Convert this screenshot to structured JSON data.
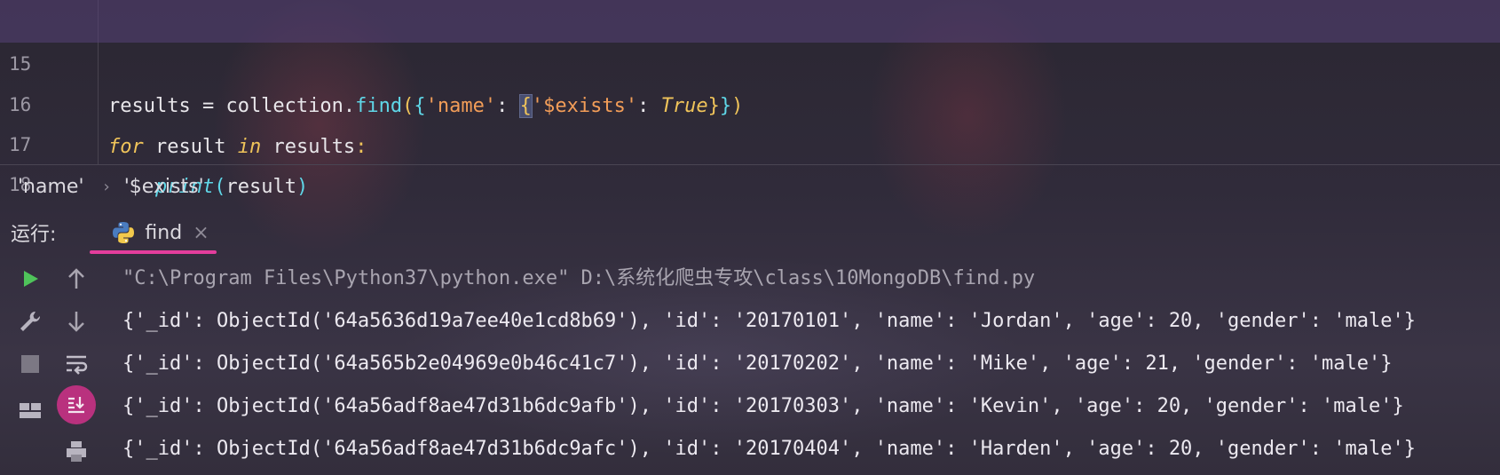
{
  "editor": {
    "lines": [
      {
        "number": "15",
        "text": "results = collection.find({'name': {'$exists': True}})"
      },
      {
        "number": "16",
        "text": "for result in results:"
      },
      {
        "number": "17",
        "text": "    print(result)"
      },
      {
        "number": "18",
        "text": ""
      }
    ]
  },
  "breadcrumb": {
    "items": [
      "'name'",
      "'$exists'"
    ],
    "separator": "›"
  },
  "run_panel": {
    "label": "运行:",
    "tab": {
      "name": "find",
      "icon": "python-icon",
      "close": "×"
    },
    "accent_color": "#e43d9c"
  },
  "toolbar": {
    "left": [
      "rerun-icon",
      "wrench-icon",
      "stop-icon",
      "layout-icon"
    ],
    "right": [
      "up-arrow-icon",
      "down-arrow-icon",
      "soft-wrap-icon",
      "scroll-to-end-icon",
      "print-icon"
    ]
  },
  "console": {
    "command": "\"C:\\Program Files\\Python37\\python.exe\" D:\\系统化爬虫专攻\\class\\10MongoDB\\find.py",
    "output": [
      "{'_id': ObjectId('64a5636d19a7ee40e1cd8b69'), 'id': '20170101', 'name': 'Jordan', 'age': 20, 'gender': 'male'}",
      "{'_id': ObjectId('64a565b2e04969e0b46c41c7'), 'id': '20170202', 'name': 'Mike', 'age': 21, 'gender': 'male'}",
      "{'_id': ObjectId('64a56adf8ae47d31b6dc9afb'), 'id': '20170303', 'name': 'Kevin', 'age': 20, 'gender': 'male'}",
      "{'_id': ObjectId('64a56adf8ae47d31b6dc9afc'), 'id': '20170404', 'name': 'Harden', 'age': 20, 'gender': 'male'}"
    ]
  }
}
